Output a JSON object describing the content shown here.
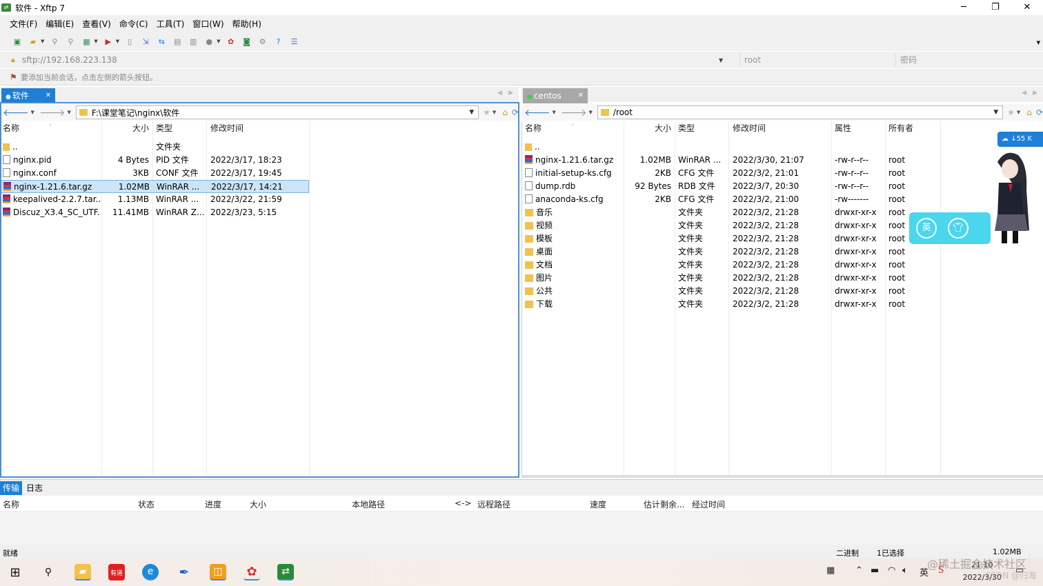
{
  "window": {
    "title": "软件 - Xftp 7",
    "min": "─",
    "max": "❐",
    "close": "✕"
  },
  "menu": [
    "文件(F)",
    "编辑(E)",
    "查看(V)",
    "命令(C)",
    "工具(T)",
    "窗口(W)",
    "帮助(H)"
  ],
  "address": {
    "url": "sftp://192.168.223.138",
    "user_placeholder": "root",
    "password_placeholder": "密码"
  },
  "hint": "要添加当前会话，点击左侧的箭头按钮。",
  "left": {
    "tab": "软件",
    "path": "F:\\课堂笔记\\nginx\\软件",
    "headers": {
      "name": "名称",
      "size": "大小",
      "type": "类型",
      "mtime": "修改时间"
    },
    "rows": [
      {
        "icon": "up",
        "name": "..",
        "size": "",
        "type": "文件夹",
        "mtime": ""
      },
      {
        "icon": "file",
        "name": "nginx.pid",
        "size": "4 Bytes",
        "type": "PID 文件",
        "mtime": "2022/3/17, 18:23"
      },
      {
        "icon": "file",
        "name": "nginx.conf",
        "size": "3KB",
        "type": "CONF 文件",
        "mtime": "2022/3/17, 19:45"
      },
      {
        "icon": "rar",
        "name": "nginx-1.21.6.tar.gz",
        "size": "1.02MB",
        "type": "WinRAR ...",
        "mtime": "2022/3/17, 14:21",
        "selected": true
      },
      {
        "icon": "rar",
        "name": "keepalived-2.2.7.tar...",
        "size": "1.13MB",
        "type": "WinRAR ...",
        "mtime": "2022/3/22, 21:59"
      },
      {
        "icon": "rar",
        "name": "Discuz_X3.4_SC_UTF...",
        "size": "11.41MB",
        "type": "WinRAR Z...",
        "mtime": "2022/3/23, 5:15"
      }
    ]
  },
  "right": {
    "tab": "centos",
    "path": "/root",
    "headers": {
      "name": "名称",
      "size": "大小",
      "type": "类型",
      "mtime": "修改时间",
      "attr": "属性",
      "owner": "所有者"
    },
    "rows": [
      {
        "icon": "up",
        "name": "..",
        "size": "",
        "type": "",
        "mtime": "",
        "attr": "",
        "owner": ""
      },
      {
        "icon": "rar",
        "name": "nginx-1.21.6.tar.gz",
        "size": "1.02MB",
        "type": "WinRAR ...",
        "mtime": "2022/3/30, 21:07",
        "attr": "-rw-r--r--",
        "owner": "root"
      },
      {
        "icon": "file",
        "name": "initial-setup-ks.cfg",
        "size": "2KB",
        "type": "CFG 文件",
        "mtime": "2022/3/2, 21:01",
        "attr": "-rw-r--r--",
        "owner": "root"
      },
      {
        "icon": "file",
        "name": "dump.rdb",
        "size": "92 Bytes",
        "type": "RDB 文件",
        "mtime": "2022/3/7, 20:30",
        "attr": "-rw-r--r--",
        "owner": "root"
      },
      {
        "icon": "file",
        "name": "anaconda-ks.cfg",
        "size": "2KB",
        "type": "CFG 文件",
        "mtime": "2022/3/2, 21:00",
        "attr": "-rw-------",
        "owner": "root"
      },
      {
        "icon": "fold",
        "name": "音乐",
        "size": "",
        "type": "文件夹",
        "mtime": "2022/3/2, 21:28",
        "attr": "drwxr-xr-x",
        "owner": "root"
      },
      {
        "icon": "fold",
        "name": "视频",
        "size": "",
        "type": "文件夹",
        "mtime": "2022/3/2, 21:28",
        "attr": "drwxr-xr-x",
        "owner": "root"
      },
      {
        "icon": "fold",
        "name": "模板",
        "size": "",
        "type": "文件夹",
        "mtime": "2022/3/2, 21:28",
        "attr": "drwxr-xr-x",
        "owner": "root"
      },
      {
        "icon": "fold",
        "name": "桌面",
        "size": "",
        "type": "文件夹",
        "mtime": "2022/3/2, 21:28",
        "attr": "drwxr-xr-x",
        "owner": "root"
      },
      {
        "icon": "fold",
        "name": "文档",
        "size": "",
        "type": "文件夹",
        "mtime": "2022/3/2, 21:28",
        "attr": "drwxr-xr-x",
        "owner": "root"
      },
      {
        "icon": "fold",
        "name": "图片",
        "size": "",
        "type": "文件夹",
        "mtime": "2022/3/2, 21:28",
        "attr": "drwxr-xr-x",
        "owner": "root"
      },
      {
        "icon": "fold",
        "name": "公共",
        "size": "",
        "type": "文件夹",
        "mtime": "2022/3/2, 21:28",
        "attr": "drwxr-xr-x",
        "owner": "root"
      },
      {
        "icon": "fold",
        "name": "下载",
        "size": "",
        "type": "文件夹",
        "mtime": "2022/3/2, 21:28",
        "attr": "drwxr-xr-x",
        "owner": "root"
      }
    ]
  },
  "lower_tabs": {
    "transfer": "传输",
    "log": "日志"
  },
  "transfer_headers": [
    "名称",
    "状态",
    "进度",
    "大小",
    "本地路径",
    "<->",
    "远程路径",
    "速度",
    "估计剩余...",
    "经过时间"
  ],
  "status": {
    "ready": "就绪",
    "mode": "二进制",
    "selected": "1已选择",
    "size": "1.02MB"
  },
  "taskbar": {
    "ime": "英",
    "time": "21:10",
    "date": "2022/3/30",
    "youdao": "有道"
  },
  "widget": {
    "cloud": "↓55 K"
  },
  "watermark": {
    "line1": "@稀土掘金技术社区",
    "line2": "CSDN @归海"
  },
  "colors": {
    "accent": "#1e7fd6",
    "selection": "#cce4f7",
    "folder": "#f2c14e"
  }
}
